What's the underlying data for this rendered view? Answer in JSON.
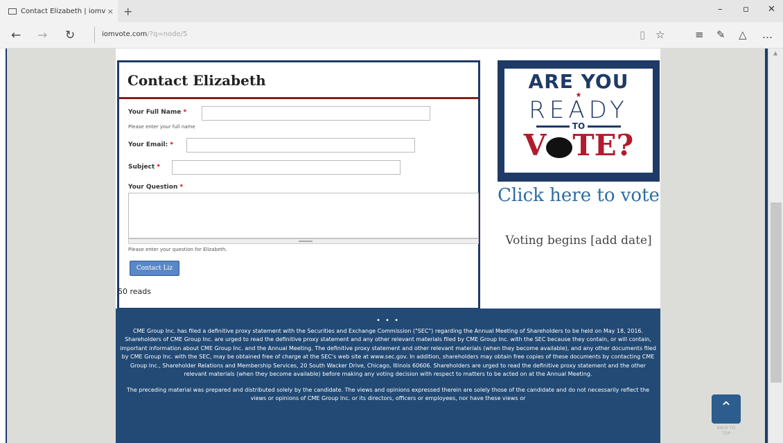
{
  "browser": {
    "tab_title": "Contact Elizabeth | iomv",
    "tab_close": "×",
    "new_tab": "+",
    "url_domain": "iomvote.com",
    "url_path": "/?q=node/5",
    "min": "–",
    "max": "▫",
    "close": "✕",
    "back": "←",
    "forward": "→",
    "refresh": "↻",
    "reading": "▯",
    "favorite": "☆",
    "hub": "≡",
    "notes": "✎",
    "share": "△",
    "more": "…"
  },
  "contact": {
    "title": "Contact Elizabeth",
    "name_label": "Your Full Name",
    "name_hint": "Please enter your full name",
    "email_label": "Your Email:",
    "subject_label": "Subject",
    "question_label": "Your Question",
    "question_hint": "Please enter your question for Elizabeth.",
    "required_mark": "*",
    "submit": "Contact Liz",
    "reads": "50 reads"
  },
  "ad": {
    "line1": "ARE YOU",
    "line2": "READY",
    "line3": "TO",
    "line4a": "V",
    "line4b": "TE?",
    "click_text": "Click here to vote",
    "begins_text": "Voting begins [add date]"
  },
  "footer": {
    "dots": "• • •",
    "para1": "CME Group Inc. has filed a definitive proxy statement with the Securities and Exchange Commission (\"SEC\") regarding the Annual Meeting of Shareholders to be held on May 18, 2016. Shareholders of CME Group Inc. are urged to read the definitive proxy statement and any other relevant materials filed by CME Group Inc. with the SEC because they contain, or will contain, important information about CME Group Inc. and the Annual Meeting. The definitive proxy statement and other relevant materials (when they become available), and any other documents filed by CME Group Inc. with the SEC, may be obtained free of charge at the SEC's web site at www.sec.gov. In addition, shareholders may obtain free copies of these documents by contacting CME Group Inc., Shareholder Relations and Membership Services, 20 South Wacker Drive, Chicago, Illinois 60606. Shareholders are urged to read the definitive proxy statement and the other relevant materials (when they become available) before making any voting decision with respect to matters to be acted on at the Annual Meeting.",
    "para2": "The preceding material was prepared and distributed solely by the candidate. The views and opinions expressed therein are solely those of the candidate and do not necessarily reflect the views or opinions of CME Group Inc. or its directors, officers or employees, nor have these views or"
  },
  "back_to_top": {
    "arrow": "⌃",
    "label": "BACK TO TOP"
  }
}
